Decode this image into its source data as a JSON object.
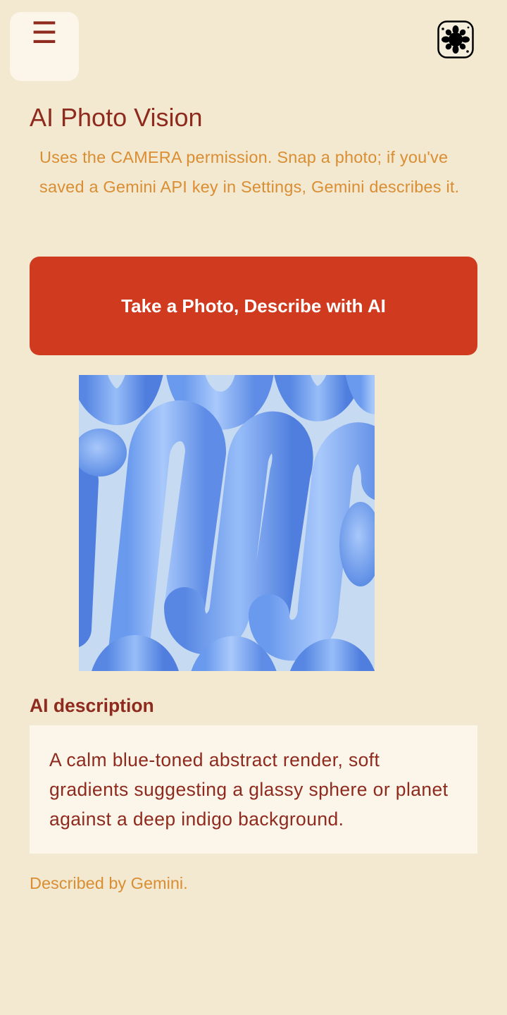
{
  "header": {
    "menu_icon_glyph": "☰",
    "menu_icon": "menu-icon",
    "logo_icon": "splat-logo-icon"
  },
  "page": {
    "title": "AI Photo Vision",
    "subtitle": "Uses the CAMERA permission. Snap a photo; if you've saved a Gemini API key in Settings, Gemini describes it."
  },
  "action": {
    "primary_button_label": "Take a Photo, Describe with AI"
  },
  "photo": {
    "content": "blue abstract tubular loops image"
  },
  "description": {
    "section_label": "AI description",
    "text": "A calm blue-toned abstract render, soft gradients suggesting a glassy sphere or planet against a deep indigo background.",
    "attribution": "Described by Gemini."
  },
  "colors": {
    "background": "#F3E8D0",
    "card": "#FCF5EA",
    "accent": "#D03A1E",
    "title_text": "#8E2A1E",
    "muted_text": "#DA8E33"
  }
}
